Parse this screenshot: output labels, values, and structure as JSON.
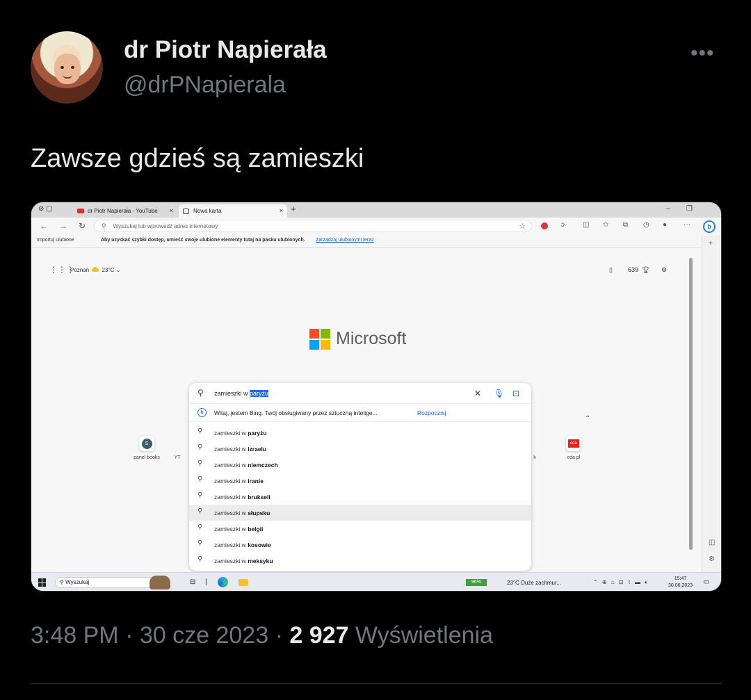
{
  "tweet": {
    "display_name": "dr Piotr Napierała",
    "handle": "@drPNapierala",
    "more_label": "•••",
    "text": "Zawsze gdzieś są zamieszki",
    "time": "3:48 PM",
    "date": "30 cze 2023",
    "separator": "·",
    "views_count": "2 927",
    "views_label": "Wyświetlenia"
  },
  "screenshot": {
    "tabs": [
      {
        "label": "dr Piotr Napierała - YouTube",
        "close": "×"
      },
      {
        "label": "Nowa karta",
        "close": "×"
      }
    ],
    "new_tab": "+",
    "address_placeholder": "Wyszukaj lub wprowadź adres internetowy",
    "favorites_bar": {
      "import": "Importuj ulubione",
      "message": "Aby uzyskać szybki dostęp, umieść swoje ulubione elementy tutaj na pasku ulubionych.",
      "manage_link": "Zarządzaj ulubionymi teraz"
    },
    "weather": {
      "city": "Poznań",
      "temp": "23°C"
    },
    "points": "639",
    "brand": "Microsoft",
    "search": {
      "typed": "zamieszki w",
      "highlighted": "paryżu",
      "bing_prompt": "Witaj, jestem Bing. Twój obsługiwany przez sztuczną intelige...",
      "bing_action": "Rozpocznij",
      "suggestion_prefix": "zamieszki w",
      "suggestions": [
        "paryżu",
        "izraelu",
        "niemczech",
        "iranie",
        "brukseli",
        "słupsku",
        "belgii",
        "kosowie",
        "meksyku"
      ]
    },
    "tiles": [
      {
        "label": "panel books",
        "letter": "S"
      },
      {
        "label": "YT"
      },
      {
        "label": "k"
      },
      {
        "label": "cda.pl",
        "letter": "cda"
      }
    ],
    "taskbar": {
      "search": "Wyszukaj",
      "battery": "96%",
      "weather": "23°C  Duże zachmur...",
      "time": "15:47",
      "date": "30.06.2023"
    }
  },
  "colors": {
    "background": "#000000",
    "text_primary": "#e7e9ea",
    "text_secondary": "#71767b",
    "ms_red": "#f25022",
    "ms_green": "#7fba00",
    "ms_blue": "#00a4ef",
    "ms_yellow": "#ffb900"
  }
}
